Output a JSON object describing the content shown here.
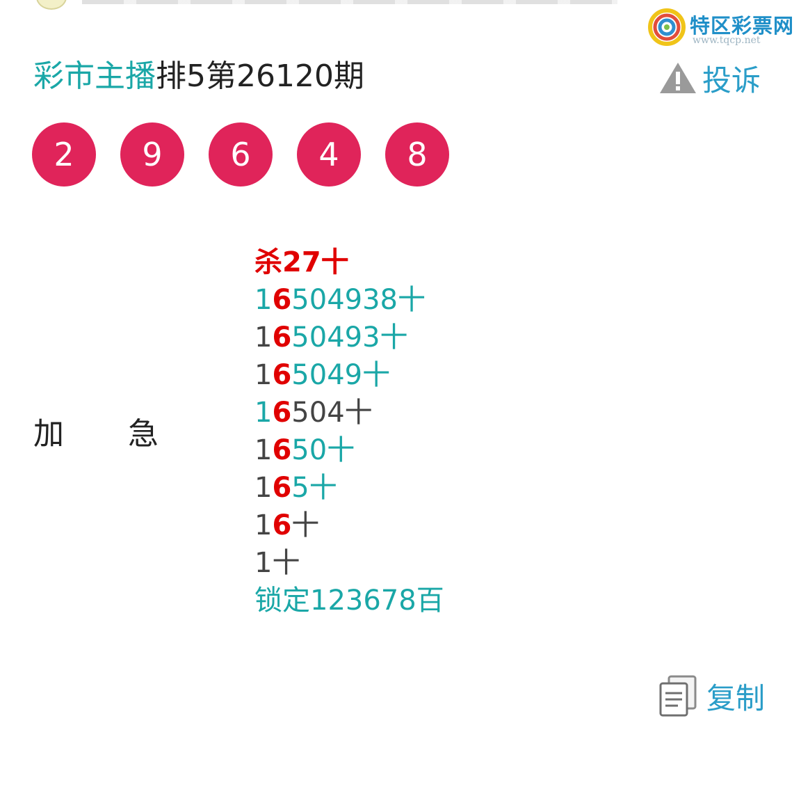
{
  "logo": {
    "name": "特区彩票网",
    "url": "www.tqcp.net",
    "colors": [
      "#f0c419",
      "#e24d3b",
      "#2f8fd0",
      "#7cc04b"
    ]
  },
  "header": {
    "title_part1": "彩市主播",
    "title_part2": "排5第26120期",
    "complain_label": "投诉",
    "complain_icon": "warning-triangle-icon"
  },
  "balls": [
    "2",
    "9",
    "6",
    "4",
    "8"
  ],
  "labels": {
    "left": "加",
    "right": "急"
  },
  "predictions": {
    "kill": "杀27十",
    "lines": [
      {
        "a": "1",
        "b": "6",
        "c": "504938十"
      },
      {
        "a": "1",
        "b": "6",
        "c": "50493十"
      },
      {
        "a": "1",
        "b": "6",
        "c": "5049十"
      },
      {
        "a": "1",
        "b": "6",
        "c": "504十"
      },
      {
        "a": "1",
        "b": "6",
        "c": "50十"
      },
      {
        "a": "1",
        "b": "6",
        "c": "5十"
      },
      {
        "a": "1",
        "b": "6",
        "c": "十"
      }
    ],
    "last": "1十",
    "lock": "锁定123678百"
  },
  "copy": {
    "label": "复制",
    "icon": "copy-document-icon"
  },
  "colors": {
    "ball": "#e0245a",
    "teal": "#1aa7a7",
    "red": "#e00000",
    "link": "#2a9dc8"
  }
}
